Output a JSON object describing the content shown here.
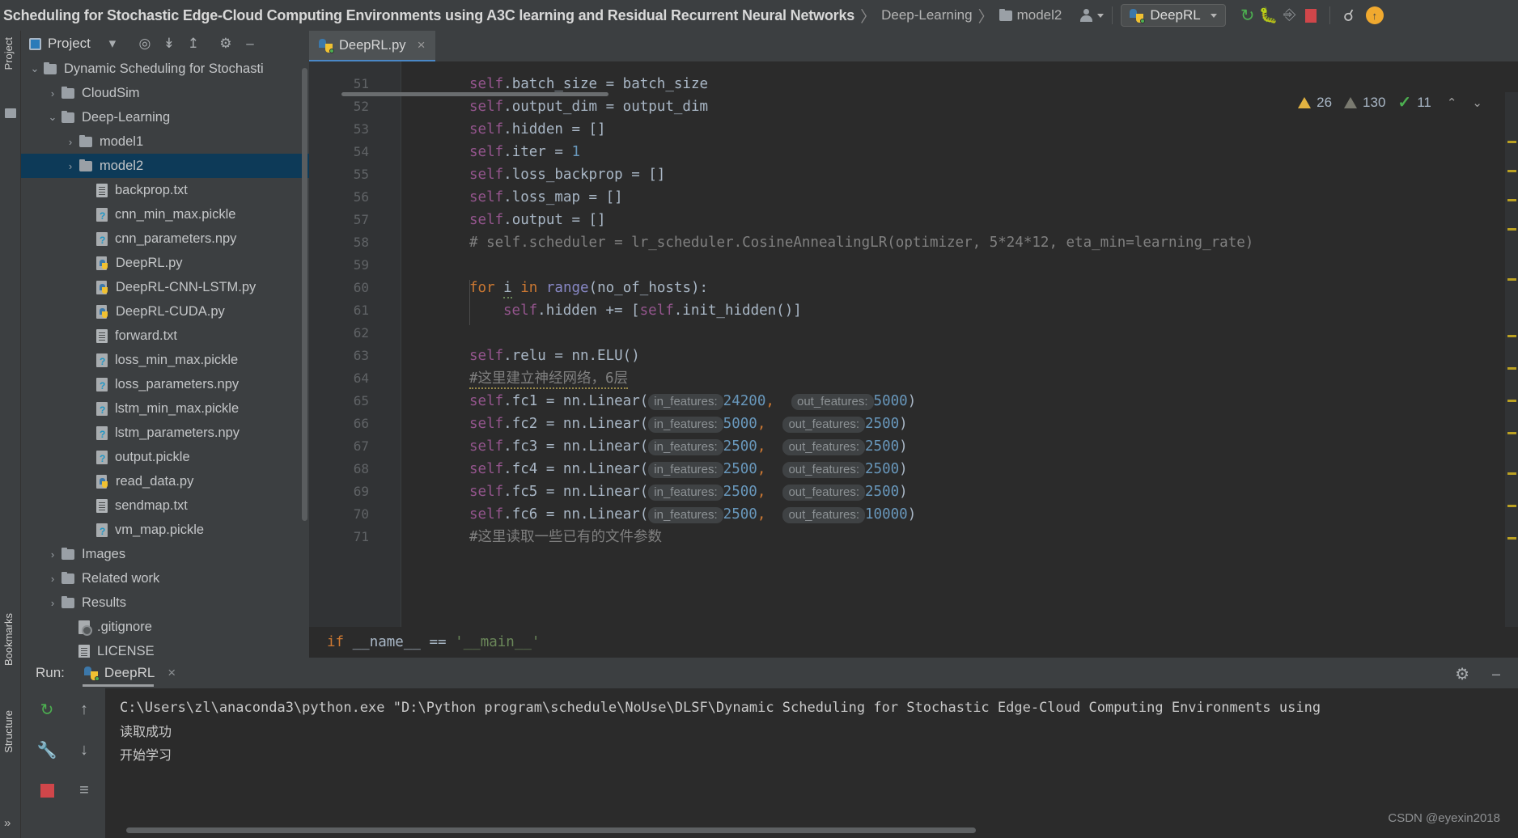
{
  "titlebar": {
    "project_title": "Scheduling for Stochastic Edge-Cloud Computing Environments using A3C learning and Residual Recurrent Neural Networks",
    "breadcrumbs": [
      "Deep-Learning",
      "model2"
    ],
    "separator": "〉",
    "run_config": "DeepRL",
    "icons": {
      "person": "person-icon",
      "dropdown": "chevron-down-icon",
      "run": "run-icon",
      "debug": "debug-icon",
      "coverage": "coverage-icon",
      "stop": "stop-icon",
      "search": "search-icon",
      "update": "update-icon"
    },
    "update_glyph": "↑"
  },
  "left_stripe": {
    "project_label": "Project",
    "bookmarks_label": "Bookmarks",
    "structure_label": "Structure",
    "expand_glyph": "»"
  },
  "project_panel": {
    "title": "Project",
    "toolbar_icons": [
      "project-view-icon",
      "chevron-down-icon",
      "locate-icon",
      "expand-all-icon",
      "collapse-all-icon",
      "settings-icon",
      "hide-icon"
    ],
    "tree": [
      {
        "label": "Dynamic Scheduling for Stochasti",
        "indent": 0,
        "arrow": "⌄",
        "icon": "folder",
        "selected": false
      },
      {
        "label": "CloudSim",
        "indent": 1,
        "arrow": "›",
        "icon": "folder",
        "selected": false
      },
      {
        "label": "Deep-Learning",
        "indent": 1,
        "arrow": "⌄",
        "icon": "folder",
        "selected": false
      },
      {
        "label": "model1",
        "indent": 2,
        "arrow": "›",
        "icon": "folder",
        "selected": false
      },
      {
        "label": "model2",
        "indent": 2,
        "arrow": "›",
        "icon": "folder",
        "selected": true
      },
      {
        "label": "backprop.txt",
        "indent": 3,
        "arrow": "",
        "icon": "txt",
        "selected": false
      },
      {
        "label": "cnn_min_max.pickle",
        "indent": 3,
        "arrow": "",
        "icon": "unk",
        "selected": false
      },
      {
        "label": "cnn_parameters.npy",
        "indent": 3,
        "arrow": "",
        "icon": "unk",
        "selected": false
      },
      {
        "label": "DeepRL.py",
        "indent": 3,
        "arrow": "",
        "icon": "py",
        "selected": false
      },
      {
        "label": "DeepRL-CNN-LSTM.py",
        "indent": 3,
        "arrow": "",
        "icon": "py",
        "selected": false
      },
      {
        "label": "DeepRL-CUDA.py",
        "indent": 3,
        "arrow": "",
        "icon": "py",
        "selected": false
      },
      {
        "label": "forward.txt",
        "indent": 3,
        "arrow": "",
        "icon": "txt",
        "selected": false
      },
      {
        "label": "loss_min_max.pickle",
        "indent": 3,
        "arrow": "",
        "icon": "unk",
        "selected": false
      },
      {
        "label": "loss_parameters.npy",
        "indent": 3,
        "arrow": "",
        "icon": "unk",
        "selected": false
      },
      {
        "label": "lstm_min_max.pickle",
        "indent": 3,
        "arrow": "",
        "icon": "unk",
        "selected": false
      },
      {
        "label": "lstm_parameters.npy",
        "indent": 3,
        "arrow": "",
        "icon": "unk",
        "selected": false
      },
      {
        "label": "output.pickle",
        "indent": 3,
        "arrow": "",
        "icon": "unk",
        "selected": false
      },
      {
        "label": "read_data.py",
        "indent": 3,
        "arrow": "",
        "icon": "py",
        "selected": false
      },
      {
        "label": "sendmap.txt",
        "indent": 3,
        "arrow": "",
        "icon": "txt",
        "selected": false
      },
      {
        "label": "vm_map.pickle",
        "indent": 3,
        "arrow": "",
        "icon": "unk",
        "selected": false
      },
      {
        "label": "Images",
        "indent": 1,
        "arrow": "›",
        "icon": "folder",
        "selected": false
      },
      {
        "label": "Related work",
        "indent": 1,
        "arrow": "›",
        "icon": "folder",
        "selected": false
      },
      {
        "label": "Results",
        "indent": 1,
        "arrow": "›",
        "icon": "folder",
        "selected": false
      },
      {
        "label": ".gitignore",
        "indent": 2,
        "arrow": "",
        "icon": "git",
        "selected": false
      },
      {
        "label": "LICENSE",
        "indent": 2,
        "arrow": "",
        "icon": "txt",
        "selected": false
      }
    ]
  },
  "editor": {
    "tab": {
      "name": "DeepRL.py",
      "close_glyph": "×"
    },
    "inspection": {
      "warnings": "26",
      "weak_warnings": "130",
      "checks": "11",
      "up_glyph": "⌃",
      "down_glyph": "⌄"
    },
    "first_line_number": 51,
    "lines": [
      {
        "n": 51,
        "indent": 8,
        "segments": [
          {
            "t": "self",
            "c": "k-self"
          },
          {
            "t": ".batch_size = batch_size",
            "c": "k-attr"
          }
        ]
      },
      {
        "n": 52,
        "indent": 8,
        "segments": [
          {
            "t": "self",
            "c": "k-self"
          },
          {
            "t": ".output_dim = output_dim",
            "c": "k-attr"
          }
        ]
      },
      {
        "n": 53,
        "indent": 8,
        "segments": [
          {
            "t": "self",
            "c": "k-self"
          },
          {
            "t": ".hidden = []",
            "c": "k-attr"
          }
        ]
      },
      {
        "n": 54,
        "indent": 8,
        "segments": [
          {
            "t": "self",
            "c": "k-self"
          },
          {
            "t": ".iter = ",
            "c": "k-attr"
          },
          {
            "t": "1",
            "c": "k-num"
          }
        ]
      },
      {
        "n": 55,
        "indent": 8,
        "segments": [
          {
            "t": "self",
            "c": "k-self"
          },
          {
            "t": ".loss_backprop = []",
            "c": "k-attr"
          }
        ]
      },
      {
        "n": 56,
        "indent": 8,
        "segments": [
          {
            "t": "self",
            "c": "k-self"
          },
          {
            "t": ".loss_map = []",
            "c": "k-attr"
          }
        ]
      },
      {
        "n": 57,
        "indent": 8,
        "segments": [
          {
            "t": "self",
            "c": "k-self"
          },
          {
            "t": ".output = []",
            "c": "k-attr"
          }
        ]
      },
      {
        "n": 58,
        "indent": 8,
        "segments": [
          {
            "t": "# self.scheduler = lr_scheduler.CosineAnnealingLR(optimizer, 5*24*12, eta_min=learning_rate)",
            "c": "k-cmt"
          }
        ]
      },
      {
        "n": 59,
        "indent": 8,
        "segments": []
      },
      {
        "n": 60,
        "indent": 8,
        "segments": [
          {
            "t": "for",
            "c": "k-kw"
          },
          {
            "t": " ",
            "c": "k-attr"
          },
          {
            "t": "i",
            "c": "k-attr squig"
          },
          {
            "t": " ",
            "c": "k-attr"
          },
          {
            "t": "in",
            "c": "k-kw"
          },
          {
            "t": " ",
            "c": "k-attr"
          },
          {
            "t": "range",
            "c": "k-fn"
          },
          {
            "t": "(no_of_hosts):",
            "c": "k-attr"
          }
        ]
      },
      {
        "n": 61,
        "indent": 12,
        "segments": [
          {
            "t": "self",
            "c": "k-self"
          },
          {
            "t": ".hidden += [",
            "c": "k-attr"
          },
          {
            "t": "self",
            "c": "k-self"
          },
          {
            "t": ".init_hidden()]",
            "c": "k-attr"
          }
        ]
      },
      {
        "n": 62,
        "indent": 8,
        "segments": []
      },
      {
        "n": 63,
        "indent": 8,
        "segments": [
          {
            "t": "self",
            "c": "k-self"
          },
          {
            "t": ".relu = nn.ELU()",
            "c": "k-attr"
          }
        ]
      },
      {
        "n": 64,
        "indent": 8,
        "segments": [
          {
            "t": "#这里建立神经网络，6层",
            "c": "k-cmt squig-w"
          }
        ]
      },
      {
        "n": 65,
        "indent": 8,
        "segments": [
          {
            "t": "self",
            "c": "k-self"
          },
          {
            "t": ".fc1 = nn.Linear(",
            "c": "k-attr"
          },
          {
            "t": "in_features:",
            "c": "hint"
          },
          {
            "t": "24200",
            "c": "k-num"
          },
          {
            "t": ",",
            "c": "k-kw"
          },
          {
            "t": "  ",
            "c": "k-attr"
          },
          {
            "t": "out_features:",
            "c": "hint"
          },
          {
            "t": "5000",
            "c": "k-num"
          },
          {
            "t": ")",
            "c": "k-attr"
          }
        ]
      },
      {
        "n": 66,
        "indent": 8,
        "segments": [
          {
            "t": "self",
            "c": "k-self"
          },
          {
            "t": ".fc2 = nn.Linear(",
            "c": "k-attr"
          },
          {
            "t": "in_features:",
            "c": "hint"
          },
          {
            "t": "5000",
            "c": "k-num"
          },
          {
            "t": ",",
            "c": "k-kw"
          },
          {
            "t": "  ",
            "c": "k-attr"
          },
          {
            "t": "out_features:",
            "c": "hint"
          },
          {
            "t": "2500",
            "c": "k-num"
          },
          {
            "t": ")",
            "c": "k-attr"
          }
        ]
      },
      {
        "n": 67,
        "indent": 8,
        "segments": [
          {
            "t": "self",
            "c": "k-self"
          },
          {
            "t": ".fc3 = nn.Linear(",
            "c": "k-attr"
          },
          {
            "t": "in_features:",
            "c": "hint"
          },
          {
            "t": "2500",
            "c": "k-num"
          },
          {
            "t": ",",
            "c": "k-kw"
          },
          {
            "t": "  ",
            "c": "k-attr"
          },
          {
            "t": "out_features:",
            "c": "hint"
          },
          {
            "t": "2500",
            "c": "k-num"
          },
          {
            "t": ")",
            "c": "k-attr"
          }
        ]
      },
      {
        "n": 68,
        "indent": 8,
        "segments": [
          {
            "t": "self",
            "c": "k-self"
          },
          {
            "t": ".fc4 = nn.Linear(",
            "c": "k-attr"
          },
          {
            "t": "in_features:",
            "c": "hint"
          },
          {
            "t": "2500",
            "c": "k-num"
          },
          {
            "t": ",",
            "c": "k-kw"
          },
          {
            "t": "  ",
            "c": "k-attr"
          },
          {
            "t": "out_features:",
            "c": "hint"
          },
          {
            "t": "2500",
            "c": "k-num"
          },
          {
            "t": ")",
            "c": "k-attr"
          }
        ]
      },
      {
        "n": 69,
        "indent": 8,
        "segments": [
          {
            "t": "self",
            "c": "k-self"
          },
          {
            "t": ".fc5 = nn.Linear(",
            "c": "k-attr"
          },
          {
            "t": "in_features:",
            "c": "hint"
          },
          {
            "t": "2500",
            "c": "k-num"
          },
          {
            "t": ",",
            "c": "k-kw"
          },
          {
            "t": "  ",
            "c": "k-attr"
          },
          {
            "t": "out_features:",
            "c": "hint"
          },
          {
            "t": "2500",
            "c": "k-num"
          },
          {
            "t": ")",
            "c": "k-attr"
          }
        ]
      },
      {
        "n": 70,
        "indent": 8,
        "segments": [
          {
            "t": "self",
            "c": "k-self"
          },
          {
            "t": ".fc6 = nn.Linear(",
            "c": "k-attr"
          },
          {
            "t": "in_features:",
            "c": "hint"
          },
          {
            "t": "2500",
            "c": "k-num"
          },
          {
            "t": ",",
            "c": "k-kw"
          },
          {
            "t": "  ",
            "c": "k-attr"
          },
          {
            "t": "out_features:",
            "c": "hint"
          },
          {
            "t": "10000",
            "c": "k-num"
          },
          {
            "t": ")",
            "c": "k-attr"
          }
        ]
      },
      {
        "n": 71,
        "indent": 8,
        "segments": [
          {
            "t": "#这里读取一些已有的文件参数",
            "c": "k-cmt"
          }
        ]
      }
    ],
    "overlay_line": "if __name__ == '__main__'"
  },
  "run_panel": {
    "label": "Run:",
    "tab_name": "DeepRL",
    "close_glyph": "×",
    "gear": "settings-icon",
    "minimize": "minimize-icon",
    "tool_icons": [
      "rerun-icon",
      "wrench-icon",
      "stop-icon",
      "up-arrow-icon",
      "down-arrow-icon",
      "soft-wrap-icon"
    ],
    "console": [
      "C:\\Users\\zl\\anaconda3\\python.exe \"D:\\Python program\\schedule\\NoUse\\DLSF\\Dynamic Scheduling for Stochastic Edge-Cloud Computing Environments using",
      "读取成功",
      "开始学习"
    ],
    "watermark": "CSDN @eyexin2018"
  }
}
